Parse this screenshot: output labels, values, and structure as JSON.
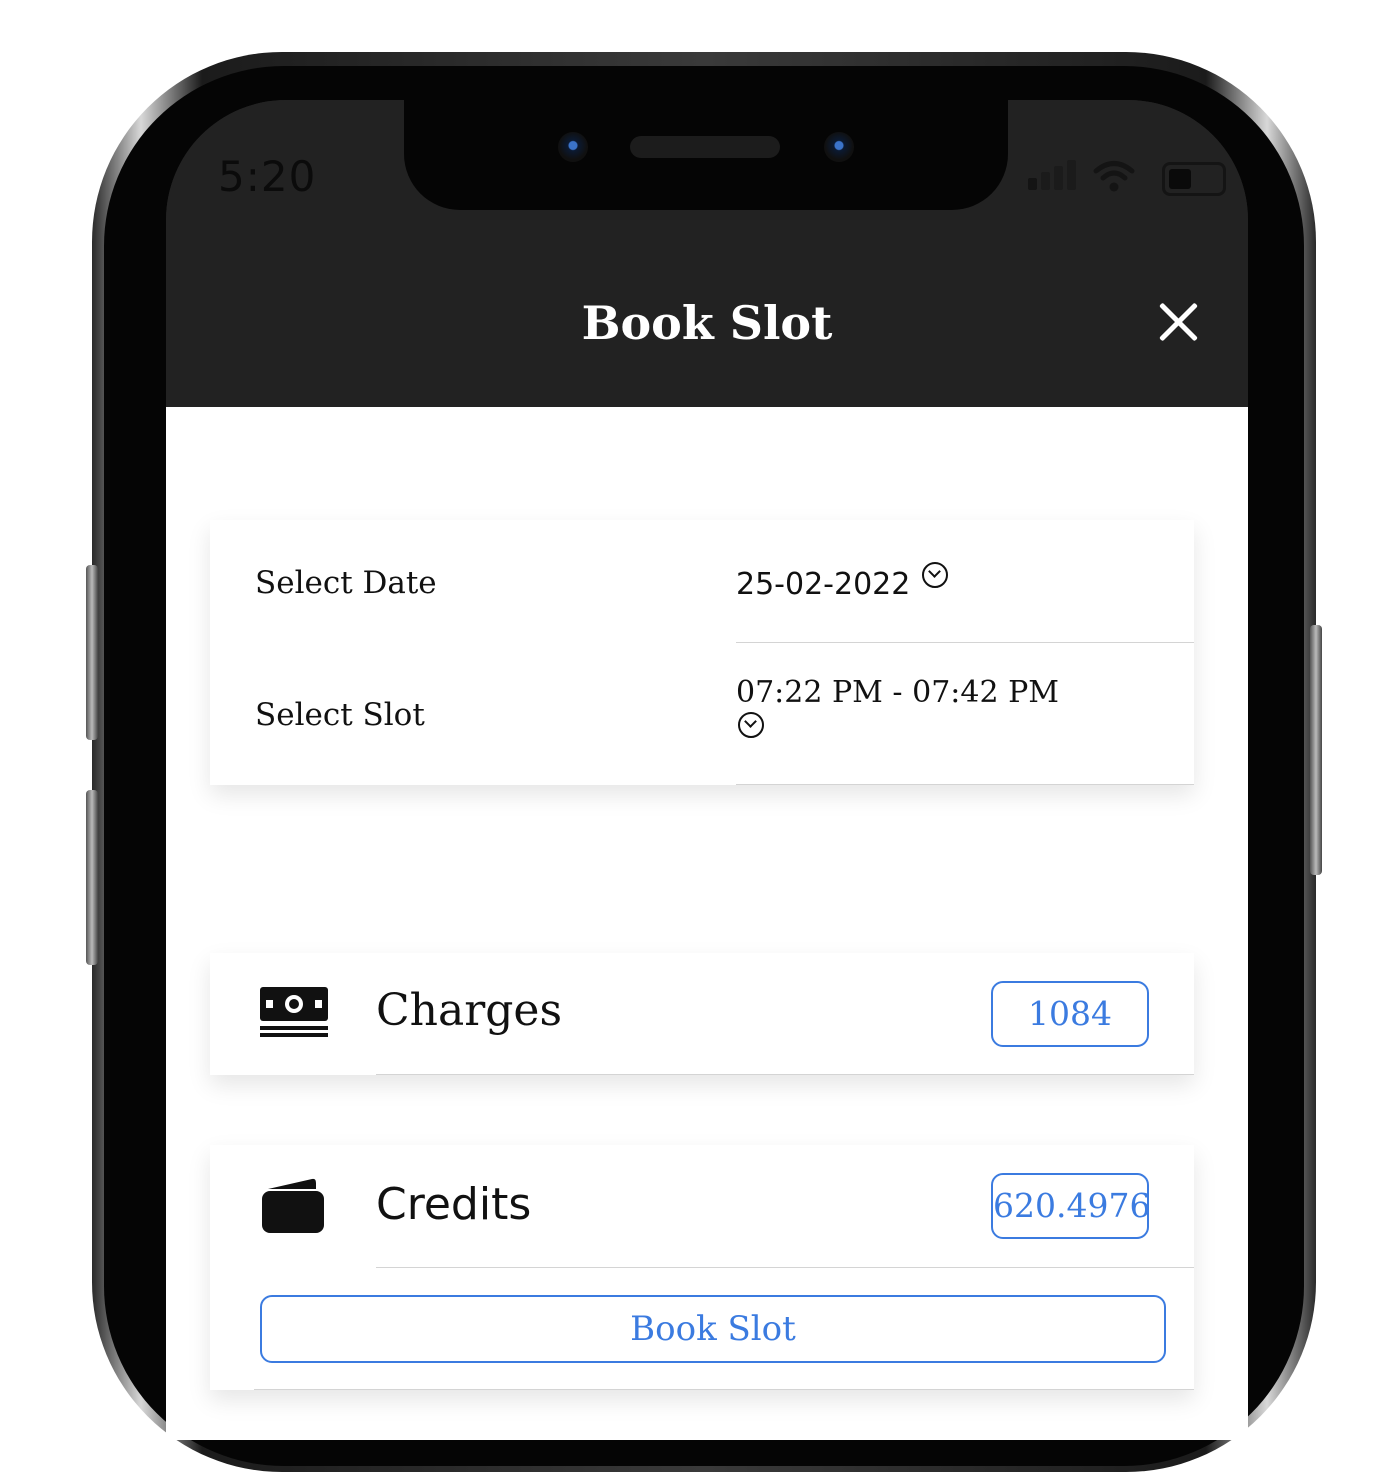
{
  "status_bar": {
    "time": "5:20"
  },
  "header": {
    "title": "Book Slot"
  },
  "booking": {
    "date_label": "Select Date",
    "date_value": "25-02-2022",
    "slot_label": "Select Slot",
    "slot_value": "07:22 PM - 07:42 PM"
  },
  "charges": {
    "label": "Charges",
    "value": "1084",
    "icon": "money-icon"
  },
  "credits": {
    "label": "Credits",
    "value": "620.4976",
    "icon": "wallet-icon"
  },
  "actions": {
    "book_label": "Book Slot"
  },
  "colors": {
    "header_bg": "#222222",
    "accent": "#3b7be0"
  }
}
